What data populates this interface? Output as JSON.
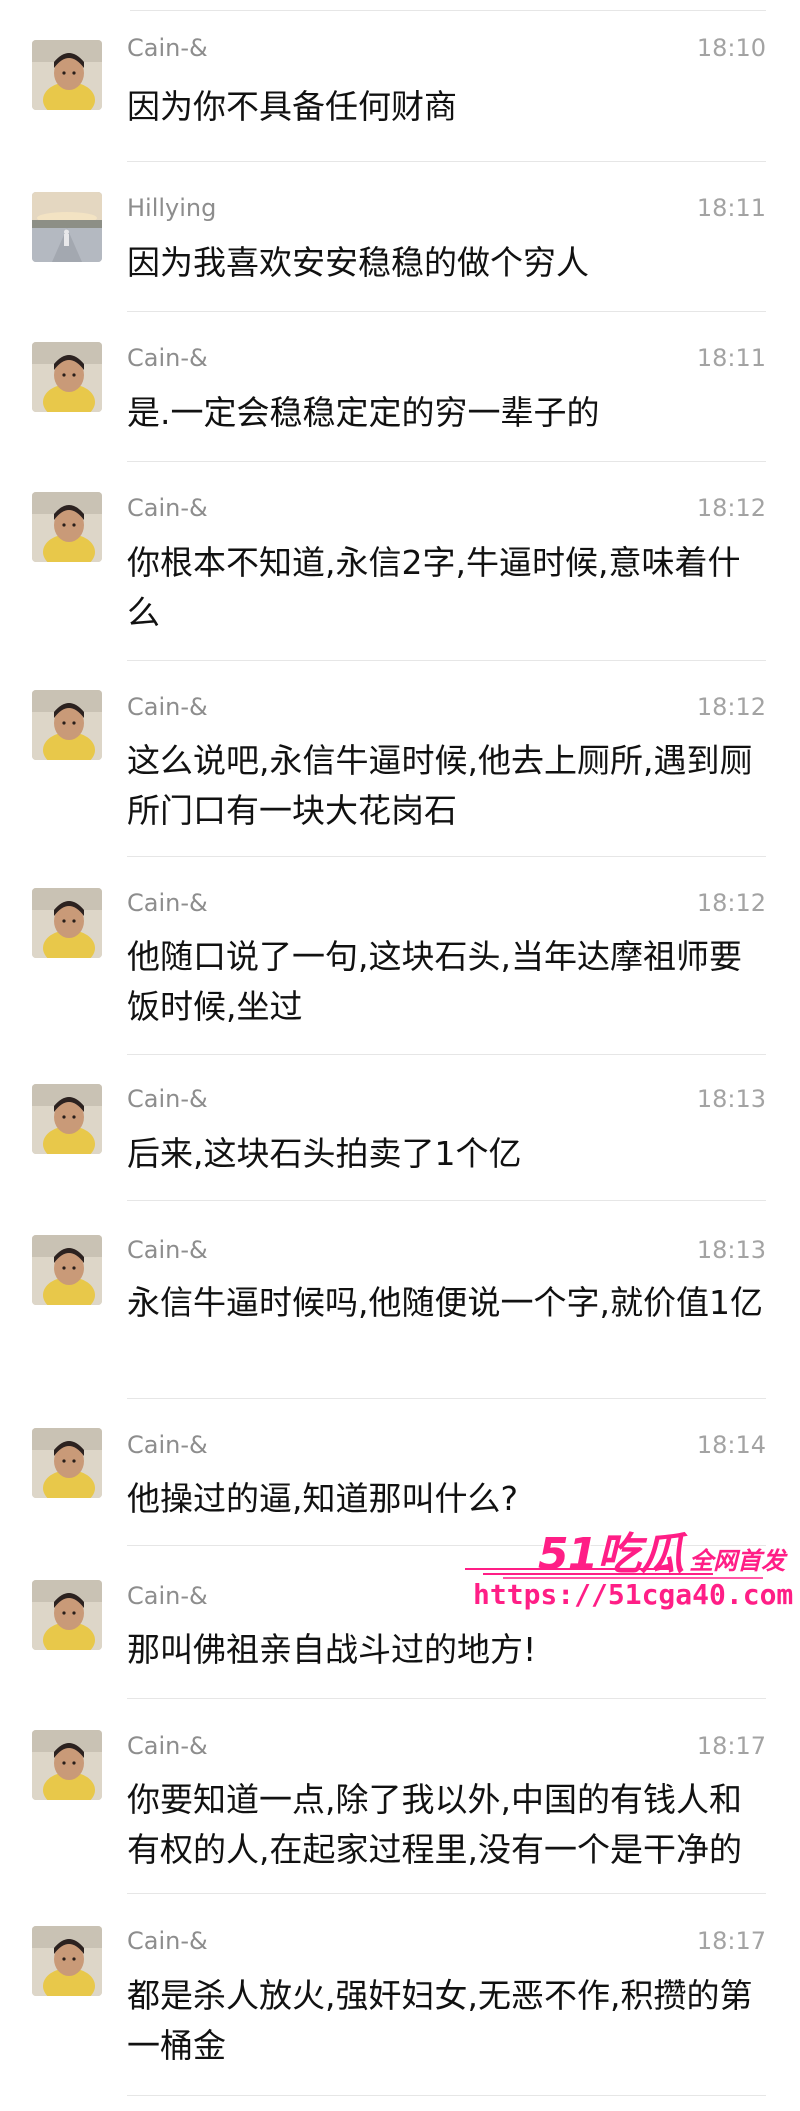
{
  "messages": [
    {
      "sender": "Cain-&",
      "time": "18:10",
      "avatar": "toddler-avatar",
      "text": "因为你不具备任何财商"
    },
    {
      "sender": "Hillying",
      "time": "18:11",
      "avatar": "landscape-avatar",
      "text": "因为我喜欢安安稳稳的做个穷人"
    },
    {
      "sender": "Cain-&",
      "time": "18:11",
      "avatar": "toddler-avatar",
      "text": "是.一定会稳稳定定的穷一辈子的"
    },
    {
      "sender": "Cain-&",
      "time": "18:12",
      "avatar": "toddler-avatar",
      "text": "你根本不知道,永信2字,牛逼时候,意味着什么"
    },
    {
      "sender": "Cain-&",
      "time": "18:12",
      "avatar": "toddler-avatar",
      "text": "这么说吧,永信牛逼时候,他去上厕所,遇到厕所门口有一块大花岗石"
    },
    {
      "sender": "Cain-&",
      "time": "18:12",
      "avatar": "toddler-avatar",
      "text": "他随口说了一句,这块石头,当年达摩祖师要饭时候,坐过"
    },
    {
      "sender": "Cain-&",
      "time": "18:13",
      "avatar": "toddler-avatar",
      "text": "后来,这块石头拍卖了1个亿"
    },
    {
      "sender": "Cain-&",
      "time": "18:13",
      "avatar": "toddler-avatar",
      "text": "永信牛逼时候吗,他随便说一个字,就价值1亿"
    },
    {
      "sender": "Cain-&",
      "time": "18:14",
      "avatar": "toddler-avatar",
      "text": "他操过的逼,知道那叫什么?"
    },
    {
      "sender": "Cain-&",
      "time": "",
      "avatar": "toddler-avatar",
      "text": "那叫佛祖亲自战斗过的地方!"
    },
    {
      "sender": "Cain-&",
      "time": "18:17",
      "avatar": "toddler-avatar",
      "text": "你要知道一点,除了我以外,中国的有钱人和有权的人,在起家过程里,没有一个是干净的"
    },
    {
      "sender": "Cain-&",
      "time": "18:17",
      "avatar": "toddler-avatar",
      "text": "都是杀人放火,强奸妇女,无恶不作,积攒的第一桶金"
    }
  ],
  "watermark": {
    "brand": "51吃瓜",
    "slogan": "全网首发",
    "url": "https://51cga40.com",
    "color": "#ff1e86"
  },
  "colors": {
    "sender": "#8d8d8d",
    "time": "#a3a3a3",
    "text": "#111111",
    "divider": "#e6e6e6"
  }
}
